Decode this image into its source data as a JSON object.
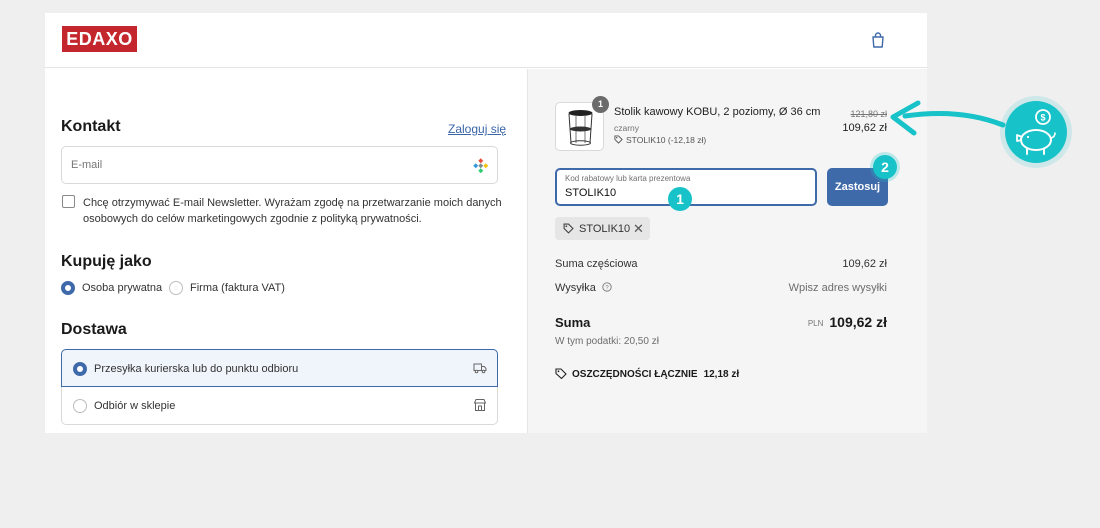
{
  "brand": {
    "name": "EDAXO",
    "accent": "#c4262e",
    "primary": "#3f6aaa",
    "highlight": "#17c2c8"
  },
  "header": {
    "cart_icon": "shopping-bag-icon"
  },
  "contact": {
    "title": "Kontakt",
    "login_link": "Zaloguj się",
    "email_placeholder": "E-mail",
    "newsletter_text": "Chcę otrzymywać E-mail Newsletter. Wyrażam zgodę na przetwarzanie moich danych osobowych do celów marketingowych zgodnie z polityką prywatności."
  },
  "buyer": {
    "title": "Kupuję jako",
    "options": [
      {
        "label": "Osoba prywatna",
        "selected": true
      },
      {
        "label": "Firma (faktura VAT)",
        "selected": false
      }
    ]
  },
  "delivery": {
    "title": "Dostawa",
    "options": [
      {
        "label": "Przesyłka kurierska lub do punktu odbioru",
        "selected": true,
        "icon": "truck-icon"
      },
      {
        "label": "Odbiór w sklepie",
        "selected": false,
        "icon": "store-icon"
      }
    ]
  },
  "cart": {
    "item": {
      "quantity": "1",
      "name": "Stolik kawowy KOBU, 2 poziomy, Ø 36 cm",
      "variant": "czarny",
      "discount": "STOLIK10 (-12,18 zł)",
      "old_price": "121,80 zł",
      "price": "109,62 zł"
    },
    "coupon": {
      "label": "Kod rabatowy lub karta prezentowa",
      "value": "STOLIK10",
      "apply_label": "Zastosuj",
      "applied_chip": "STOLIK10"
    },
    "summary": {
      "subtotal_label": "Suma częściowa",
      "subtotal_value": "109,62 zł",
      "shipping_label": "Wysyłka",
      "shipping_value": "Wpisz adres wysyłki",
      "total_label": "Suma",
      "total_currency": "PLN",
      "total_value": "109,62 zł",
      "tax_text": "W tym podatki: 20,50 zł",
      "savings_label": "OSZCZĘDNOŚCI ŁĄCZNIE",
      "savings_value": "12,18 zł"
    }
  },
  "annotations": {
    "step1": "1",
    "step2": "2",
    "piggy_icon": "piggy-bank-icon"
  }
}
